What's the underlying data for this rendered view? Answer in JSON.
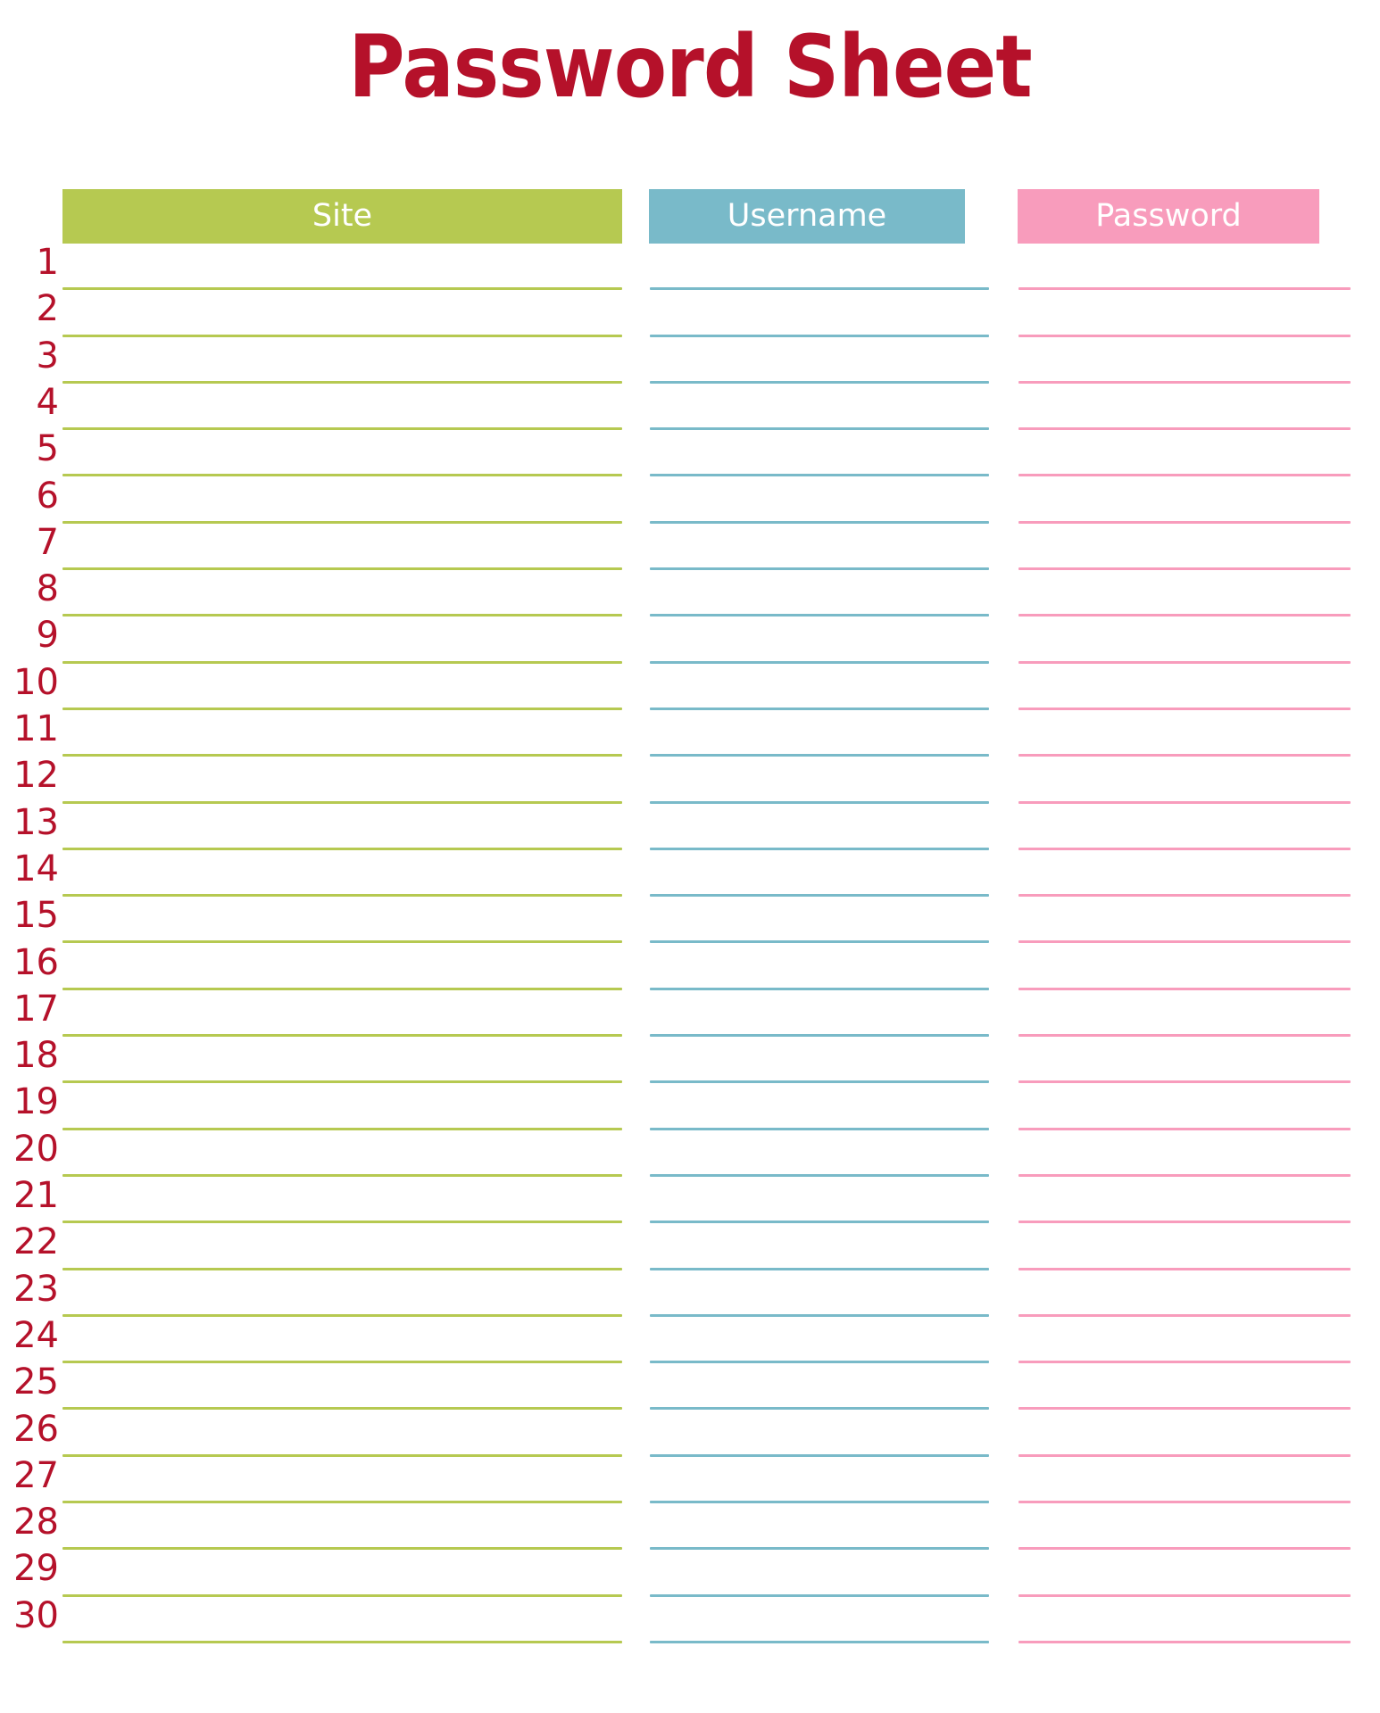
{
  "page": {
    "title": "Password Sheet",
    "row_count": 30
  },
  "colors": {
    "title_red": "#b5112a",
    "site_green": "#b6c951",
    "username_blue": "#79bac9",
    "password_pink": "#f89cbc",
    "header_text": "#ffffff",
    "background": "#ffffff"
  },
  "table": {
    "columns": [
      {
        "key": "site",
        "label": "Site",
        "color": "#b6c951"
      },
      {
        "key": "username",
        "label": "Username",
        "color": "#79bac9"
      },
      {
        "key": "password",
        "label": "Password",
        "color": "#f89cbc"
      }
    ],
    "row_numbers": [
      "1",
      "2",
      "3",
      "4",
      "5",
      "6",
      "7",
      "8",
      "9",
      "10",
      "11",
      "12",
      "13",
      "14",
      "15",
      "16",
      "17",
      "18",
      "19",
      "20",
      "21",
      "22",
      "23",
      "24",
      "25",
      "26",
      "27",
      "28",
      "29",
      "30"
    ],
    "rows": [
      {
        "number": "1",
        "site": "",
        "username": "",
        "password": ""
      },
      {
        "number": "2",
        "site": "",
        "username": "",
        "password": ""
      },
      {
        "number": "3",
        "site": "",
        "username": "",
        "password": ""
      },
      {
        "number": "4",
        "site": "",
        "username": "",
        "password": ""
      },
      {
        "number": "5",
        "site": "",
        "username": "",
        "password": ""
      },
      {
        "number": "6",
        "site": "",
        "username": "",
        "password": ""
      },
      {
        "number": "7",
        "site": "",
        "username": "",
        "password": ""
      },
      {
        "number": "8",
        "site": "",
        "username": "",
        "password": ""
      },
      {
        "number": "9",
        "site": "",
        "username": "",
        "password": ""
      },
      {
        "number": "10",
        "site": "",
        "username": "",
        "password": ""
      },
      {
        "number": "11",
        "site": "",
        "username": "",
        "password": ""
      },
      {
        "number": "12",
        "site": "",
        "username": "",
        "password": ""
      },
      {
        "number": "13",
        "site": "",
        "username": "",
        "password": ""
      },
      {
        "number": "14",
        "site": "",
        "username": "",
        "password": ""
      },
      {
        "number": "15",
        "site": "",
        "username": "",
        "password": ""
      },
      {
        "number": "16",
        "site": "",
        "username": "",
        "password": ""
      },
      {
        "number": "17",
        "site": "",
        "username": "",
        "password": ""
      },
      {
        "number": "18",
        "site": "",
        "username": "",
        "password": ""
      },
      {
        "number": "19",
        "site": "",
        "username": "",
        "password": ""
      },
      {
        "number": "20",
        "site": "",
        "username": "",
        "password": ""
      },
      {
        "number": "21",
        "site": "",
        "username": "",
        "password": ""
      },
      {
        "number": "22",
        "site": "",
        "username": "",
        "password": ""
      },
      {
        "number": "23",
        "site": "",
        "username": "",
        "password": ""
      },
      {
        "number": "24",
        "site": "",
        "username": "",
        "password": ""
      },
      {
        "number": "25",
        "site": "",
        "username": "",
        "password": ""
      },
      {
        "number": "26",
        "site": "",
        "username": "",
        "password": ""
      },
      {
        "number": "27",
        "site": "",
        "username": "",
        "password": ""
      },
      {
        "number": "28",
        "site": "",
        "username": "",
        "password": ""
      },
      {
        "number": "29",
        "site": "",
        "username": "",
        "password": ""
      },
      {
        "number": "30",
        "site": "",
        "username": "",
        "password": ""
      }
    ]
  }
}
